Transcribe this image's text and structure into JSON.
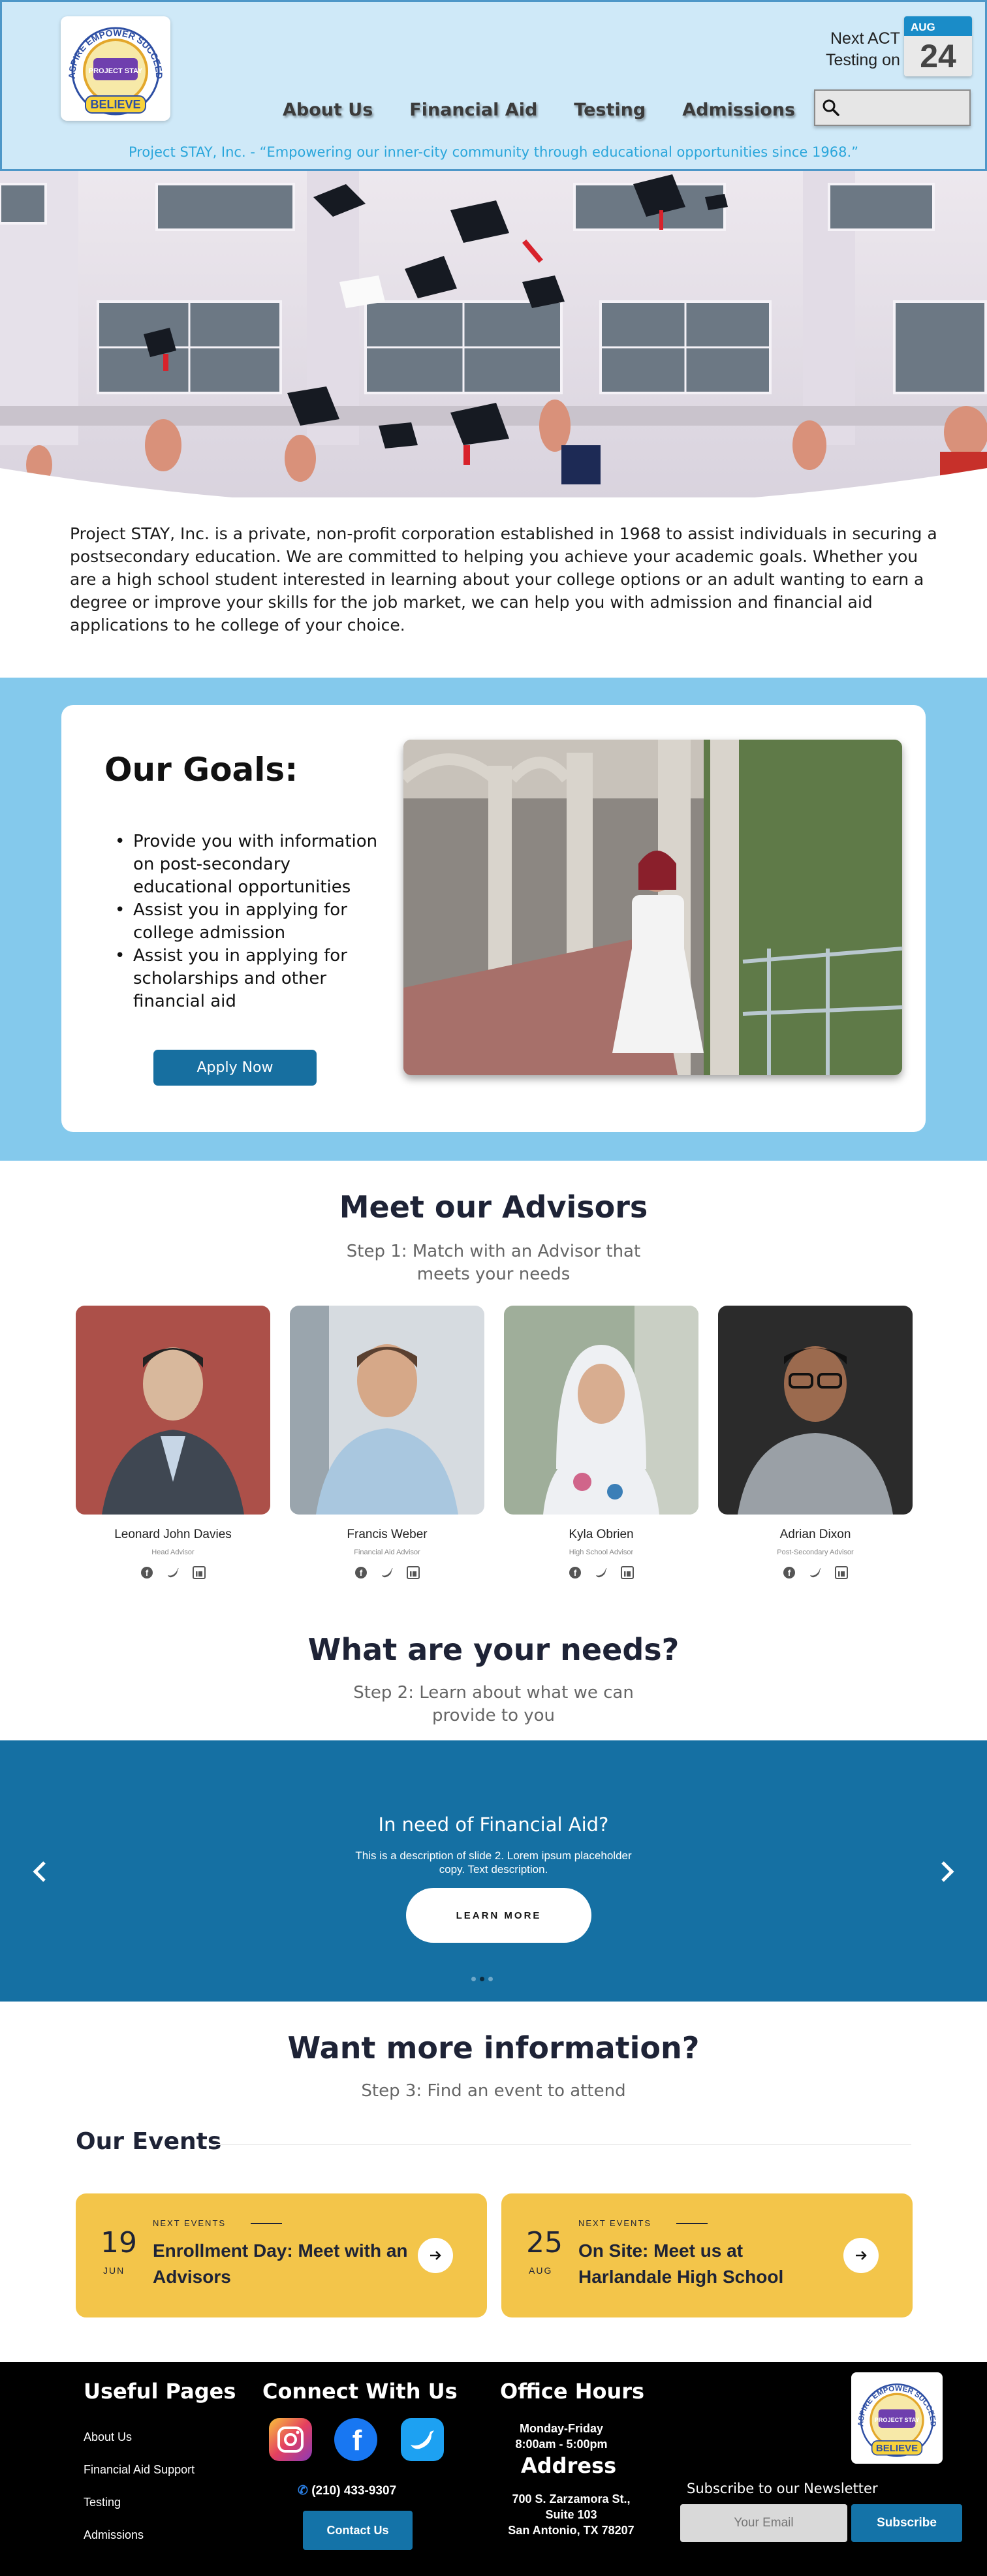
{
  "header": {
    "logo_alt": "Project STAY logo",
    "nav": [
      "About Us",
      "Financial Aid",
      "Testing",
      "Admissions"
    ],
    "act_line1": "Next ACT",
    "act_line2": "Testing on",
    "act_month": "AUG",
    "act_day": "24",
    "search_placeholder": "",
    "tagline": "Project STAY, Inc. - “Empowering our inner-city community through educational opportunities since 1968.”"
  },
  "logo_text": {
    "top": "ASPIRE EMPOWER SUCCEED",
    "middle": "PROJECT STAY",
    "bottom": "BELIEVE"
  },
  "intro": "Project STAY, Inc. is a private, non-profit corporation established in 1968 to assist individuals in securing a postsecondary education. We are committed to helping you achieve your academic goals. Whether you are a high school student interested in learning about your college options or an adult wanting to earn a degree or improve your skills for the job market, we can help you with admission and financial aid applications to he college of your choice.",
  "goals": {
    "title": "Our Goals:",
    "items": [
      "Provide you with information on post-secondary educational opportunities",
      "Assist you in applying for college admission",
      "Assist you in applying for scholarships and other financial aid"
    ],
    "button": "Apply Now"
  },
  "advisors": {
    "title": "Meet our Advisors",
    "subtitle": "Step 1: Match with an Advisor that meets your needs",
    "people": [
      {
        "name": "Leonard John Davies",
        "role": "Head Advisor"
      },
      {
        "name": "Francis Weber",
        "role": "Financial Aid Advisor"
      },
      {
        "name": "Kyla Obrien",
        "role": "High School Advisor"
      },
      {
        "name": "Adrian Dixon",
        "role": "Post-Secondary Advisor"
      }
    ]
  },
  "needs": {
    "title": "What are your needs?",
    "subtitle": "Step 2: Learn about what we can provide to you"
  },
  "carousel": {
    "title": "In need of Financial Aid?",
    "description": "This is a description of slide 2. Lorem ipsum placeholder copy. Text description.",
    "button": "LEARN MORE",
    "slide_count": 3,
    "active_slide": 2
  },
  "info": {
    "title": "Want more information?",
    "subtitle": "Step 3: Find an event to attend"
  },
  "events": {
    "title": "Our Events",
    "items": [
      {
        "day": "19",
        "month": "JUN",
        "kicker": "NEXT EVENTS",
        "title": "Enrollment Day: Meet with an Advisors"
      },
      {
        "day": "25",
        "month": "AUG",
        "kicker": "NEXT EVENTS",
        "title": "On Site: Meet us at Harlandale High School"
      }
    ]
  },
  "footer": {
    "useful_title": "Useful Pages",
    "links": [
      "About Us",
      "Financial Aid Support",
      "Testing",
      "Admissions"
    ],
    "connect_title": "Connect With Us",
    "phone": "(210) 433-9307",
    "contact_button": "Contact Us",
    "hours_title": "Office Hours",
    "hours_days": "Monday-Friday",
    "hours_time": "8:00am - 5:00pm",
    "address_title": "Address",
    "address_line1": "700 S. Zarzamora St.,",
    "address_line2": "Suite 103",
    "address_line3": "San Antonio, TX 78207",
    "newsletter_label": "Subscribe to our Newsletter",
    "newsletter_placeholder": "Your Email",
    "newsletter_button": "Subscribe"
  },
  "colors": {
    "header_bg": "#cfe9f8",
    "tagline": "#2aa6db",
    "goals_band": "#84c9ec",
    "primary_button": "#176fa0",
    "carousel_bg": "#1570a3",
    "event_card": "#f3c54a",
    "footer_bg": "#000000"
  },
  "icons": [
    "search-icon",
    "calendar-icon",
    "facebook-icon",
    "twitter-icon",
    "linkedin-icon",
    "chevron-left-icon",
    "chevron-right-icon",
    "arrow-right-icon",
    "instagram-icon",
    "phone-icon"
  ]
}
